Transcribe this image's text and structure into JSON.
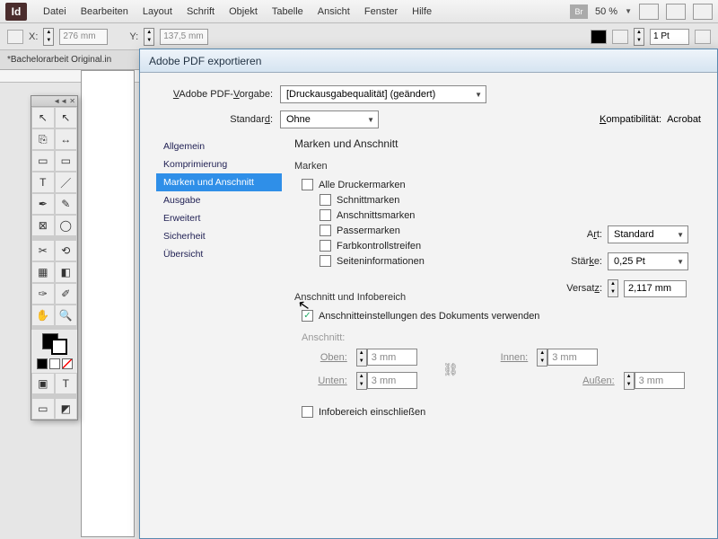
{
  "menu": {
    "items": [
      "Datei",
      "Bearbeiten",
      "Layout",
      "Schrift",
      "Objekt",
      "Tabelle",
      "Ansicht",
      "Fenster",
      "Hilfe"
    ],
    "zoom": "50 %",
    "br": "Br"
  },
  "control": {
    "x_label": "X:",
    "x_value": "276 mm",
    "y_label": "Y:",
    "y_value": "137,5 mm",
    "stroke": "1 Pt"
  },
  "doc_tab": "*Bachelorarbeit Original.in",
  "dialog": {
    "title": "Adobe PDF exportieren",
    "preset_label": "Adobe PDF-Vorgabe:",
    "preset_value": "[Druckausgabequalität] (geändert)",
    "standard_label": "Standard:",
    "standard_value": "Ohne",
    "compat_label": "Kompatibilität:",
    "compat_value": "Acrobat",
    "side": [
      "Allgemein",
      "Komprimierung",
      "Marken und Anschnitt",
      "Ausgabe",
      "Erweitert",
      "Sicherheit",
      "Übersicht"
    ],
    "side_active": 2,
    "panel_title": "Marken und Anschnitt",
    "marks": {
      "group": "Marken",
      "all": "Alle Druckermarken",
      "crop": "Schnittmarken",
      "bleed": "Anschnittsmarken",
      "reg": "Passermarken",
      "color": "Farbkontrollstreifen",
      "page": "Seiteninformationen",
      "art_label": "Art:",
      "art_value": "Standard",
      "weight_label": "Stärke:",
      "weight_value": "0,25 Pt",
      "offset_label": "Versatz:",
      "offset_value": "2,117 mm"
    },
    "bleed": {
      "group": "Anschnitt und Infobereich",
      "use_doc": "Anschnitteinstellungen des Dokuments verwenden",
      "heading": "Anschnitt:",
      "top": "Oben:",
      "bottom": "Unten:",
      "inner": "Innen:",
      "outer": "Außen:",
      "val": "3 mm",
      "slug": "Infobereich einschließen"
    }
  }
}
